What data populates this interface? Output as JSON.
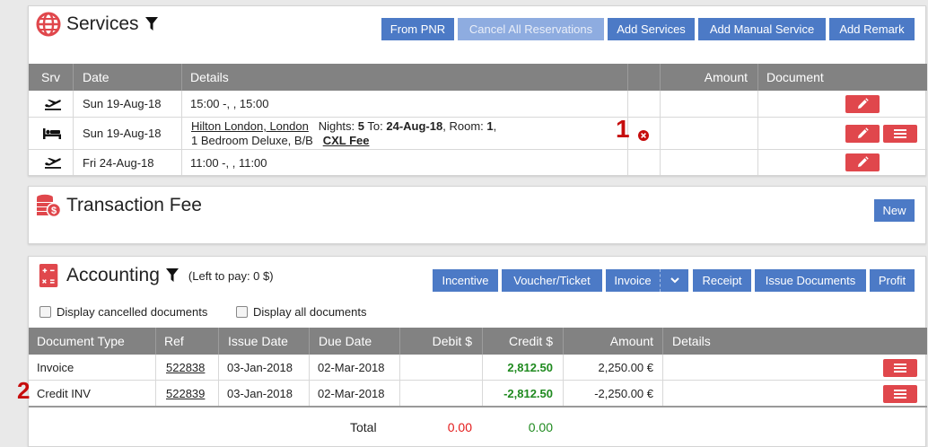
{
  "services": {
    "title": "Services",
    "buttons": [
      "From PNR",
      "Cancel All Reservations",
      "Add Services",
      "Add Manual Service",
      "Add Remark"
    ],
    "columns": [
      "Srv",
      "Date",
      "Details",
      "",
      "Amount",
      "Document"
    ],
    "rows": [
      {
        "icon": "plane-departure-icon",
        "date": "Sun 19-Aug-18",
        "details": "15:00 -, , 15:00"
      },
      {
        "icon": "bed-icon",
        "date": "Sun 19-Aug-18",
        "hotel": "Hilton London, London",
        "nights_label": "Nights:",
        "nights": "5",
        "to_label": "To:",
        "to": "24-Aug-18",
        "room_label": "Room:",
        "room": "1",
        "line2": "1 Bedroom Deluxe, B/B",
        "fee_link": "CXL Fee"
      },
      {
        "icon": "plane-departure-icon",
        "date": "Fri 24-Aug-18",
        "details": "11:00 -, , 11:00"
      }
    ]
  },
  "annotations": {
    "one": "1",
    "two": "2"
  },
  "transaction_fee": {
    "title": "Transaction Fee",
    "new_button": "New"
  },
  "accounting": {
    "title": "Accounting",
    "left_to_pay": "(Left to pay: 0 $)",
    "buttons": {
      "incentive": "Incentive",
      "voucher": "Voucher/Ticket",
      "invoice": "Invoice",
      "receipt": "Receipt",
      "issue": "Issue Documents",
      "profit": "Profit"
    },
    "checkboxes": [
      "Display cancelled documents",
      "Display all documents"
    ],
    "columns": [
      "Document Type",
      "Ref",
      "Issue Date",
      "Due Date",
      "Debit $",
      "Credit $",
      "Amount",
      "Details"
    ],
    "rows": [
      {
        "type": "Invoice",
        "ref": "522838",
        "issue": "03-Jan-2018",
        "due": "02-Mar-2018",
        "debit": "",
        "credit": "2,812.50",
        "amount": "2,250.00 €"
      },
      {
        "type": "Credit INV",
        "ref": "522839",
        "issue": "03-Jan-2018",
        "due": "02-Mar-2018",
        "debit": "",
        "credit": "-2,812.50",
        "amount": "-2,250.00 €"
      }
    ],
    "total_label": "Total",
    "total_debit": "0.00",
    "total_credit": "0.00"
  },
  "colors": {
    "primary": "#4c7ac6",
    "danger": "#e0474c",
    "header": "#828282",
    "positive": "#1f8a1f",
    "negative": "#e31b1b"
  }
}
